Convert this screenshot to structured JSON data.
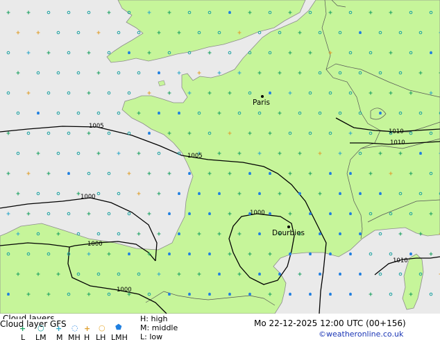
{
  "map": {
    "legend_title": "Cloud layers",
    "product": "Cloud layer  GFS",
    "valid_time": "Mo 22-12-2025 12:00 UTC (00+156)",
    "credit": "©weatheronline.co.uk",
    "cities": [
      "Paris",
      "Dourbies"
    ],
    "isobar_labels": [
      "1005",
      "1005",
      "1010",
      "1010",
      "1000",
      "1000",
      "1000",
      "1000",
      "1010"
    ],
    "legend_levels": {
      "high": "H: high",
      "middle": "M: middle",
      "low": "L: low"
    },
    "symbol_labels": [
      "L",
      "LM",
      "M",
      "MH",
      "H",
      "LH",
      "LMH"
    ],
    "symbol_colors": {
      "low": "#1aa060",
      "low_middle": "#18a0a0",
      "middle": "#2da8c8",
      "middle_high": "#1e7fe0",
      "high": "#e0a030",
      "low_high": "#e8b040",
      "low_middle_high": "#1f7fe0"
    },
    "land_color": "#c6f59a",
    "sea_color": "#eaeaea"
  }
}
